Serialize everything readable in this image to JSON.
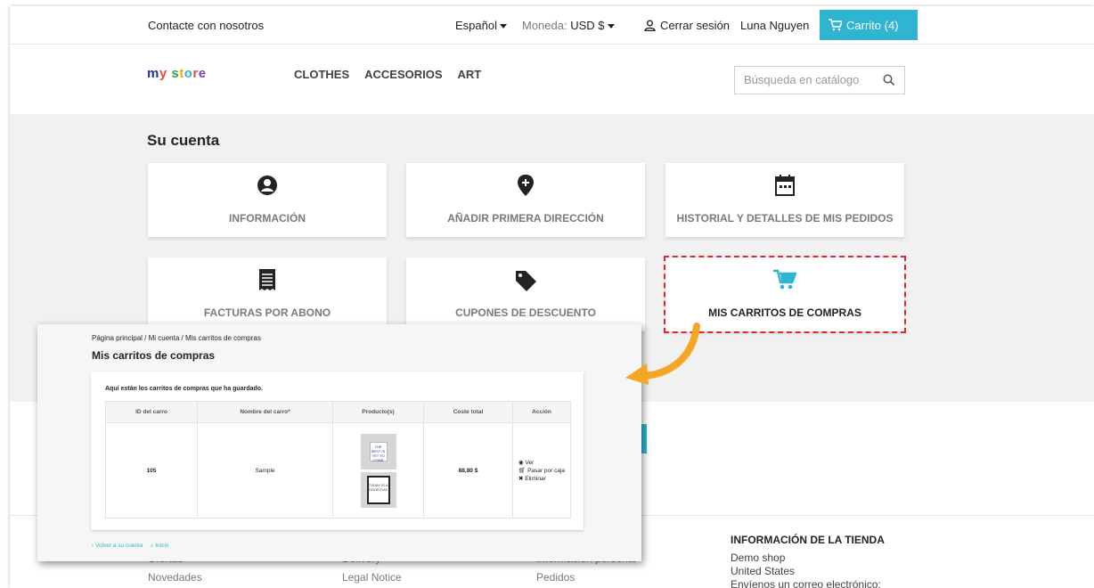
{
  "topbar": {
    "contact": "Contacte con nosotros",
    "language": "Español",
    "currency_label": "Moneda:",
    "currency_value": "USD $",
    "logout": "Cerrar sesión",
    "username": "Luna Nguyen",
    "cart": "Carrito (4)"
  },
  "header": {
    "logo": {
      "m": "m",
      "y": "y",
      "space": " ",
      "s": "s",
      "t": "t",
      "o": "o",
      "r": "r",
      "e": "e"
    },
    "menu": [
      "CLOTHES",
      "ACCESORIOS",
      "ART"
    ],
    "search_placeholder": "Búsqueda en catálogo"
  },
  "account": {
    "title": "Su cuenta",
    "tiles": [
      {
        "label": "INFORMACIÓN",
        "icon": "user-circle-icon"
      },
      {
        "label": "AÑADIR PRIMERA DIRECCIÓN",
        "icon": "map-marker-plus-icon"
      },
      {
        "label": "HISTORIAL Y DETALLES DE MIS PEDIDOS",
        "icon": "calendar-icon"
      },
      {
        "label": "FACTURAS POR ABONO",
        "icon": "receipt-icon"
      },
      {
        "label": "CUPONES DE DESCUENTO",
        "icon": "tag-icon"
      },
      {
        "label": "MIS CARRITOS DE COMPRAS",
        "icon": "shopping-cart-icon"
      }
    ]
  },
  "footer": {
    "col1": [
      "Ofertas",
      "Novedades"
    ],
    "col2": [
      "Delivery",
      "Legal Notice"
    ],
    "col3": [
      "Información personal",
      "Pedidos"
    ],
    "store_heading": "INFORMACIÓN DE LA TIENDA",
    "store_lines": [
      "Demo shop",
      "United States",
      "Envíenos un correo electrónico:"
    ]
  },
  "overlay": {
    "breadcrumb": "Página principal  /  Mi cuenta  /  Mis carritos de compras",
    "title": "Mis carritos de compras",
    "intro": "Aquí están los carritos de compras que ha guardado.",
    "columns": [
      "ID del carro",
      "Nombre del carro*",
      "Producto(s)",
      "Coste total",
      "Acción"
    ],
    "row": {
      "id": "105",
      "name": "Sample",
      "mug_text": "THE BEST IS YET TO COME",
      "poster_text": "TODAY IS A GOOD DAY",
      "total": "88,80 $",
      "actions": [
        "Ver",
        "Pasar por caja",
        "Eliminar"
      ]
    },
    "back_link": "Volver a su cuenta",
    "home_link": "Inicio"
  },
  "colors": {
    "accent": "#2fb5d2",
    "highlight_border": "#e0262b",
    "arrow": "#f5a623"
  }
}
